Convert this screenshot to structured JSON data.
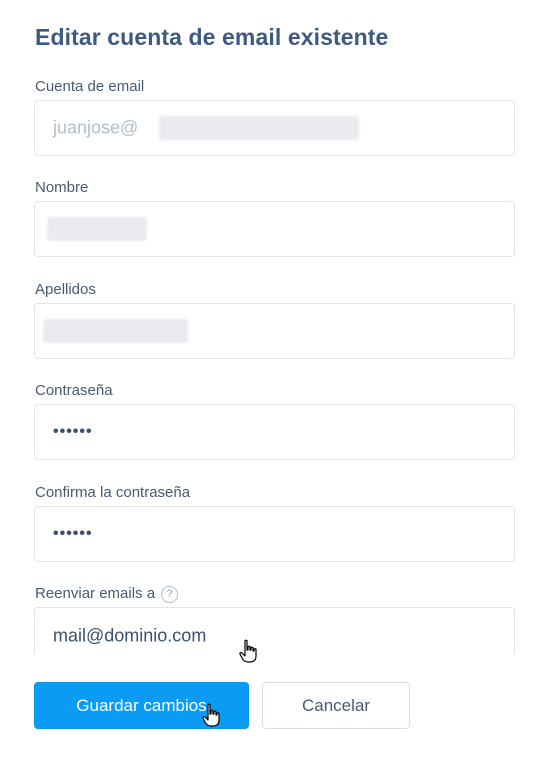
{
  "form": {
    "title": "Editar cuenta de email existente",
    "fields": {
      "email": {
        "label": "Cuenta de email",
        "value": "juanjose@"
      },
      "first_name": {
        "label": "Nombre"
      },
      "last_name": {
        "label": "Apellidos"
      },
      "password": {
        "label": "Contraseña",
        "value": "••••••"
      },
      "confirm_password": {
        "label": "Confirma la contraseña",
        "value": "••••••"
      },
      "forward": {
        "label": "Reenviar emails a",
        "value": "mail@dominio.com",
        "help": "?"
      }
    },
    "buttons": {
      "save": "Guardar cambios",
      "cancel": "Cancelar"
    }
  },
  "colors": {
    "primary": "#0a9cf5",
    "title": "#3d5a80",
    "border": "#dfe4ea"
  }
}
